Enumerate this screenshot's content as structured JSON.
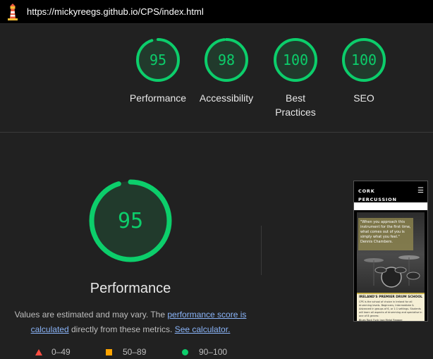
{
  "browser": {
    "url": "https://mickyreegs.github.io/CPS/index.html"
  },
  "scores": [
    {
      "label": "Performance",
      "value": "95",
      "fraction": 0.95
    },
    {
      "label": "Accessibility",
      "value": "98",
      "fraction": 0.98
    },
    {
      "label": "Best\nPractices",
      "value": "100",
      "fraction": 1.0
    },
    {
      "label": "SEO",
      "value": "100",
      "fraction": 1.0
    }
  ],
  "main": {
    "score": "95",
    "fraction": 0.95,
    "title": "Performance",
    "note_prefix": "Values are estimated and may vary. The ",
    "note_link1": "performance score is calculated",
    "note_middle": " directly from these metrics. ",
    "note_link2": "See calculator."
  },
  "legend": [
    {
      "range": "0–49",
      "color": "#ff4e42"
    },
    {
      "range": "50–89",
      "color": "#ffa400"
    },
    {
      "range": "90–100",
      "color": "#0cce6b"
    }
  ],
  "preview": {
    "site_title": "CORK PERCUSSION SCHOOL",
    "menu_icon": "hamburger-icon",
    "quote": "\"When you approach this instrument for the first time, what comes out of you is simply what you feel.\" Dennis Chambers.",
    "banner_title": "IRELAND'S PREMIER DRUM SCHOOL",
    "banner_text": "CPS is the school of choice in Ireland for all drumming levels. Beginners, Intermediate & Advanced in groups of 6, or 1:1 settings. Students will learn all aspects of drumming and specialise in one of 8 genres:",
    "banner_genres": "Blues Rock Funk Jazz Metal Reggae"
  },
  "colors": {
    "good": "#0cce6b",
    "good_bg": "#213a2c",
    "track": "#1f3a2a"
  }
}
